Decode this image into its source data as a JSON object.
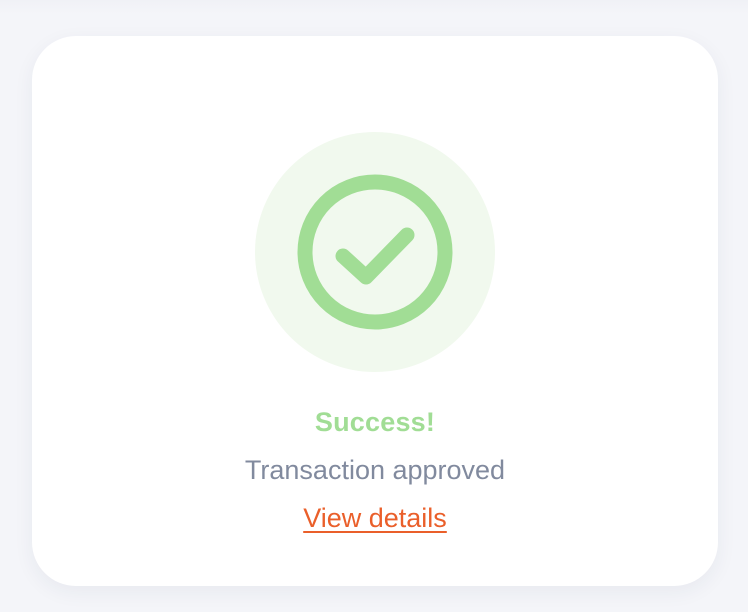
{
  "status": {
    "title": "Success!",
    "message": "Transaction approved",
    "link_label": "View details",
    "icon": "check-circle-icon"
  },
  "colors": {
    "background": "#f4f5f9",
    "card": "#ffffff",
    "success": "#a1dd95",
    "success_halo": "#f1f9ee",
    "message_text": "#818a9e",
    "link": "#ea5f2a"
  }
}
